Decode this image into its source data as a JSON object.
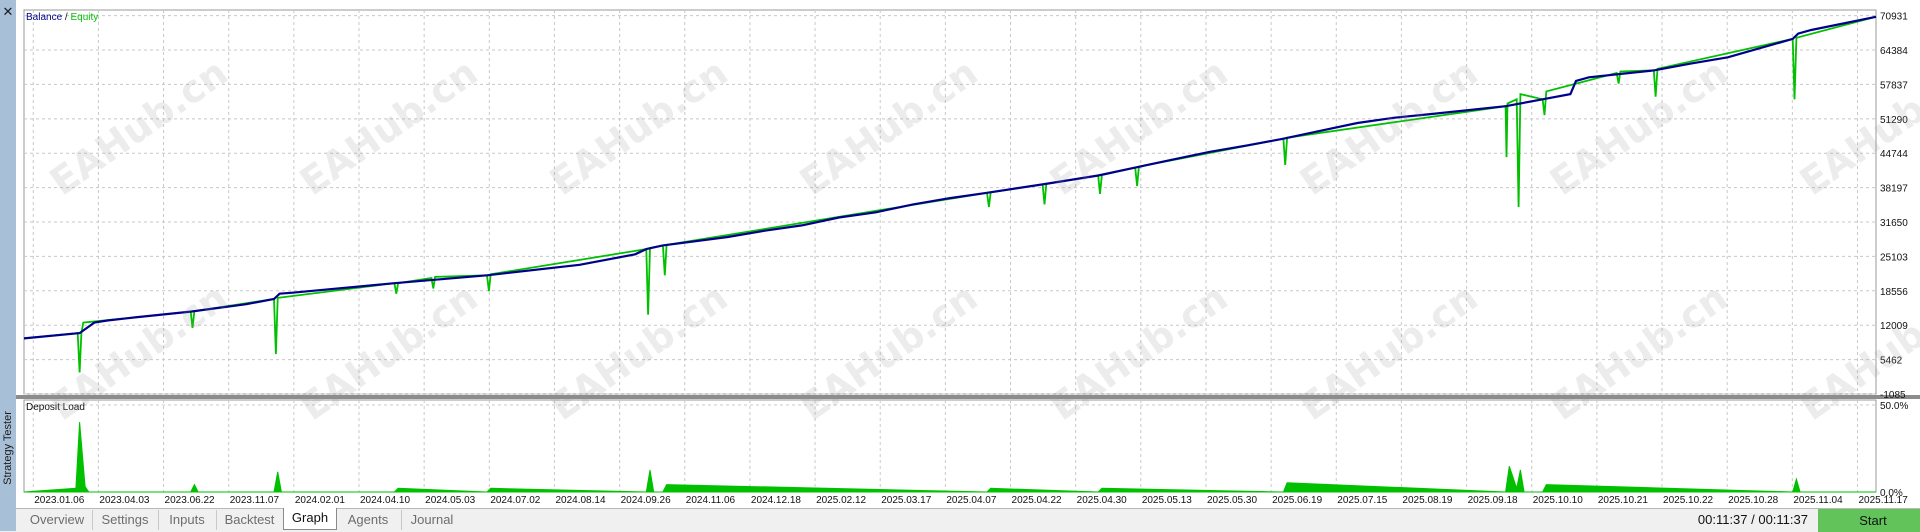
{
  "panel": {
    "title": "Strategy Tester",
    "close_icon": "close-icon",
    "close_glyph": "✕"
  },
  "colors": {
    "balance": "#00008b",
    "equity": "#00c000",
    "deposit_load": "#00c000",
    "grid": "#c8c8c8",
    "accent_start": "#61c35a"
  },
  "watermark": "EAHub.cn",
  "tabs": [
    {
      "label": "Overview",
      "active": false
    },
    {
      "label": "Settings",
      "active": false
    },
    {
      "label": "Inputs",
      "active": false
    },
    {
      "label": "Backtest",
      "active": false
    },
    {
      "label": "Graph",
      "active": true
    },
    {
      "label": "Agents",
      "active": false
    },
    {
      "label": "Journal",
      "active": false
    }
  ],
  "status": {
    "timer": "00:11:37 / 00:11:37",
    "start_label": "Start"
  },
  "chart_data": [
    {
      "type": "line",
      "legend": [
        {
          "name": "Balance",
          "color": "#00008b"
        },
        {
          "name": "Equity",
          "color": "#00c000"
        }
      ],
      "legend_separator": " / ",
      "ylim": [
        -1085,
        72000
      ],
      "y_ticks": [
        70931,
        64384,
        57837,
        51290,
        44744,
        38197,
        31650,
        25103,
        18556,
        12009,
        5462,
        -1085
      ],
      "x_ticks": [
        "2023.01.06",
        "2023.04.03",
        "2023.06.22",
        "2023.11.07",
        "2024.02.01",
        "2024.04.10",
        "2024.05.03",
        "2024.07.02",
        "2024.08.14",
        "2024.09.26",
        "2024.11.06",
        "2024.12.18",
        "2025.02.12",
        "2025.03.17",
        "2025.04.07",
        "2025.04.22",
        "2025.04.30",
        "2025.05.13",
        "2025.05.30",
        "2025.06.19",
        "2025.07.15",
        "2025.08.19",
        "2025.09.18",
        "2025.10.10",
        "2025.10.21",
        "2025.10.22",
        "2025.10.28",
        "2025.11.04",
        "2025.11.17"
      ],
      "grid": true,
      "series": [
        {
          "name": "Balance",
          "x": [
            0,
            0.03,
            0.038,
            0.045,
            0.06,
            0.09,
            0.12,
            0.135,
            0.138,
            0.145,
            0.2,
            0.25,
            0.3,
            0.33,
            0.336,
            0.345,
            0.38,
            0.4,
            0.42,
            0.44,
            0.46,
            0.48,
            0.5,
            0.52,
            0.55,
            0.58,
            0.6,
            0.62,
            0.64,
            0.66,
            0.68,
            0.7,
            0.72,
            0.74,
            0.76,
            0.8,
            0.82,
            0.835,
            0.838,
            0.845,
            0.88,
            0.9,
            0.92,
            0.955,
            0.958,
            0.965,
            1
          ],
          "values": [
            9500,
            10500,
            12500,
            12900,
            13500,
            14600,
            16000,
            17000,
            18000,
            18200,
            20000,
            21500,
            23500,
            25500,
            26500,
            27200,
            28800,
            30000,
            31000,
            32500,
            33500,
            35000,
            36200,
            37200,
            38800,
            40500,
            42000,
            43500,
            45000,
            46200,
            47500,
            49000,
            50500,
            51500,
            52200,
            53700,
            55000,
            56000,
            58500,
            59200,
            60500,
            61800,
            63000,
            66500,
            67500,
            68200,
            70700
          ]
        },
        {
          "name": "Equity",
          "x": [
            0,
            0.029,
            0.03,
            0.031,
            0.032,
            0.09,
            0.091,
            0.092,
            0.135,
            0.136,
            0.137,
            0.2,
            0.201,
            0.202,
            0.22,
            0.221,
            0.222,
            0.25,
            0.251,
            0.252,
            0.336,
            0.337,
            0.338,
            0.345,
            0.346,
            0.347,
            0.52,
            0.521,
            0.522,
            0.55,
            0.551,
            0.552,
            0.58,
            0.581,
            0.582,
            0.6,
            0.601,
            0.602,
            0.68,
            0.681,
            0.682,
            0.8,
            0.8005,
            0.801,
            0.806,
            0.807,
            0.808,
            0.82,
            0.821,
            0.822,
            0.86,
            0.861,
            0.862,
            0.88,
            0.881,
            0.882,
            0.955,
            0.956,
            0.957,
            1
          ],
          "values": [
            9500,
            10500,
            3000,
            10500,
            12500,
            14600,
            11500,
            14700,
            17000,
            6500,
            17200,
            20000,
            18000,
            20000,
            21000,
            19000,
            21200,
            21500,
            18500,
            21700,
            26500,
            14000,
            26700,
            27200,
            21500,
            27300,
            37200,
            34500,
            37300,
            38800,
            35000,
            38900,
            40500,
            37000,
            40600,
            42000,
            38500,
            42200,
            47500,
            42500,
            47700,
            53700,
            44000,
            54200,
            55000,
            34500,
            56000,
            55000,
            52000,
            56500,
            60000,
            58000,
            60300,
            60500,
            55500,
            60800,
            66500,
            55000,
            66700,
            70700
          ]
        }
      ]
    },
    {
      "type": "area",
      "title": "Deposit Load",
      "ylim": [
        0,
        50
      ],
      "y_ticks": [
        "50.0%",
        "0.0%"
      ],
      "series": [
        {
          "name": "Deposit Load",
          "x": [
            0,
            0.028,
            0.03,
            0.033,
            0.035,
            0.09,
            0.092,
            0.094,
            0.135,
            0.137,
            0.139,
            0.2,
            0.202,
            0.25,
            0.252,
            0.336,
            0.338,
            0.34,
            0.345,
            0.347,
            0.52,
            0.522,
            0.58,
            0.582,
            0.68,
            0.682,
            0.8,
            0.802,
            0.806,
            0.808,
            0.81,
            0.82,
            0.822,
            0.955,
            0.957,
            0.959,
            1
          ],
          "values": [
            0,
            2,
            38,
            3,
            0,
            0,
            4,
            0,
            0,
            11,
            0,
            0,
            2,
            0,
            2,
            0,
            12,
            0,
            0,
            4,
            0,
            2,
            0,
            2,
            0,
            5,
            0,
            14,
            2,
            12,
            0,
            0,
            4,
            0,
            7,
            0,
            0
          ]
        }
      ]
    }
  ]
}
